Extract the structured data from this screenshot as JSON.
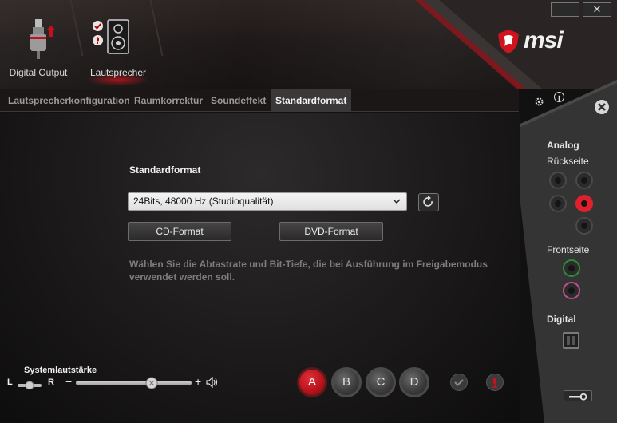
{
  "window": {
    "minimize_glyph": "—",
    "close_glyph": "✕"
  },
  "devices": [
    {
      "label": "Digital Output",
      "icon": "digital-output-jack-icon"
    },
    {
      "label": "Lautsprecher",
      "icon": "speaker-icon",
      "selected": true
    }
  ],
  "brand": {
    "logo_text": "msi",
    "icon": "msi-dragon-shield-icon"
  },
  "tabs": [
    {
      "label": "Lautsprecherkonfiguration"
    },
    {
      "label": "Raumkorrektur"
    },
    {
      "label": "Soundeffekt"
    },
    {
      "label": "Standardformat",
      "active": true
    }
  ],
  "main": {
    "section_title": "Standardformat",
    "format_select": {
      "value": "24Bits, 48000 Hz (Studioqualität)"
    },
    "cd_button": "CD-Format",
    "dvd_button": "DVD-Format",
    "description": "Wählen Sie die Abtastrate und Bit-Tiefe, die bei Ausführung im Freigabemodus verwendet werden soll."
  },
  "right_panel": {
    "analog": "Analog",
    "rear": "Rückseite",
    "front": "Frontseite",
    "digital": "Digital",
    "colors": {
      "red_jack": "#e0202c",
      "green_jack": "#2e8b3a",
      "pink_jack": "#c2508e"
    }
  },
  "bottom": {
    "volume_title": "Systemlautstärke",
    "left": "L",
    "right": "R",
    "minus": "−",
    "plus": "+",
    "volume_level": 0.62,
    "profiles": [
      "A",
      "B",
      "C",
      "D"
    ],
    "active_profile": "A"
  },
  "colors": {
    "accent": "#d0141e",
    "background": "#1b1919",
    "panel": "#353434"
  }
}
